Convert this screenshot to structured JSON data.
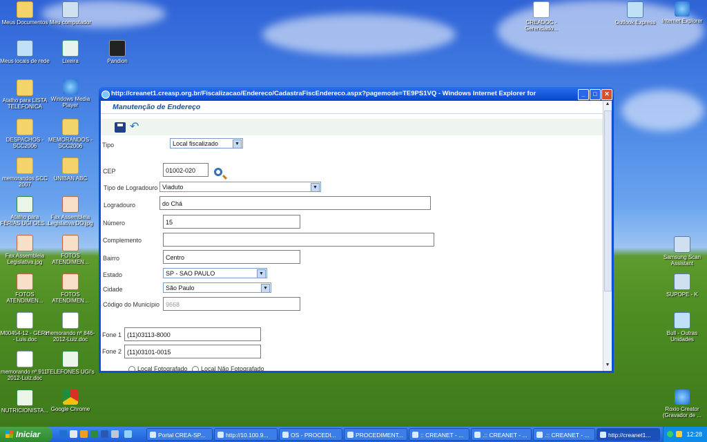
{
  "desktop": {
    "icons": [
      {
        "label": "Meus Documentos",
        "icon": "folder-icon"
      },
      {
        "label": "Meu computador",
        "icon": "computer-icon"
      },
      {
        "label": "Meus locais de rede",
        "icon": "network-icon"
      },
      {
        "label": "Lixeira",
        "icon": "recycle-bin-icon"
      },
      {
        "label": "Pandion",
        "icon": "pandion-icon"
      },
      {
        "label": "Atalho para LISTA TELEFONICA",
        "icon": "folder-icon"
      },
      {
        "label": "Windows Media Player",
        "icon": "media-player-icon"
      },
      {
        "label": "DESPACHOS - SCC2006",
        "icon": "folder-icon"
      },
      {
        "label": "MEMORANDOS - SCC2006",
        "icon": "folder-icon"
      },
      {
        "label": "memorandos SCC 2007",
        "icon": "folder-icon"
      },
      {
        "label": "UNIBAN ABC",
        "icon": "folder-icon"
      },
      {
        "label": "Atalho para FÉRIAS UGI OES...",
        "icon": "excel-icon"
      },
      {
        "label": "Fax Assembleia Legislativa DO.jpg",
        "icon": "image-icon"
      },
      {
        "label": "Fax Assembleia Legislativa.jpg",
        "icon": "image-icon"
      },
      {
        "label": "FOTOS ATENDIMEN...",
        "icon": "image-icon"
      },
      {
        "label": "FOTOS ATENDIMEN...",
        "icon": "image-icon"
      },
      {
        "label": "FOTOS ATENDIMEN...",
        "icon": "image-icon"
      },
      {
        "label": "M00454-12 - GERH - Luis.doc",
        "icon": "word-icon"
      },
      {
        "label": "memorando nº 846-2012-Luiz.doc",
        "icon": "word-icon"
      },
      {
        "label": "memorando nº 911-2012-Luiz.doc",
        "icon": "word-icon"
      },
      {
        "label": "TELEFONES UGI's",
        "icon": "excel-icon"
      },
      {
        "label": "NUTRICIONISTA...",
        "icon": "excel-icon"
      },
      {
        "label": "Google Chrome",
        "icon": "chrome-icon"
      },
      {
        "label": "CREADOC - Gerenciado...",
        "icon": "creadoc-icon"
      },
      {
        "label": "Outlook Express",
        "icon": "outlook-icon"
      },
      {
        "label": "Internet Explorer",
        "icon": "ie-icon"
      },
      {
        "label": "Samsung Scan Assistant",
        "icon": "scanner-icon"
      },
      {
        "label": "SUPOPE - K",
        "icon": "drive-icon"
      },
      {
        "label": "Bull - Outras Unidades",
        "icon": "shortcut-icon"
      },
      {
        "label": "Roxio Creator (Gravador de ...",
        "icon": "roxio-icon"
      }
    ]
  },
  "ie": {
    "title": "http://creanet1.creasp.org.br/Fiscalizacao/Endereco/CadastraFiscEndereco.aspx?pagemode=TE9PS1VQ - Windows Internet Explorer for"
  },
  "form": {
    "title": "Manutenção de Endereço",
    "tipo": {
      "label": "Tipo",
      "value": "Local fiscalizado"
    },
    "cep": {
      "label": "CEP",
      "value": "01002-020"
    },
    "tipo_logradouro": {
      "label": "Tipo de Logradouro",
      "value": "Viaduto"
    },
    "logradouro": {
      "label": "Logradouro",
      "value": "do Chá"
    },
    "numero": {
      "label": "Número",
      "value": "15"
    },
    "complemento": {
      "label": "Complemento",
      "value": ""
    },
    "bairro": {
      "label": "Bairro",
      "value": "Centro"
    },
    "estado": {
      "label": "Estado",
      "value": "SP - SAO PAULO"
    },
    "cidade": {
      "label": "Cidade",
      "value": "São Paulo"
    },
    "codigo_municipio": {
      "label": "Código do Município",
      "value": "9668"
    },
    "fone1": {
      "label": "Fone 1",
      "value": "(11)03113-8000"
    },
    "fone2": {
      "label": "Fone 2",
      "value": "(11)03101-0015"
    },
    "radio_fotografado": "Local Fotografado",
    "radio_nao_fotografado": "Local Não Fotografado"
  },
  "taskbar": {
    "start": "Iniciar",
    "tasks": [
      "Portal CREA-SP...",
      "http://10.100.9...",
      "OS - PROCEDI...",
      "PROCEDIMENT...",
      ":: CREANET - ...",
      ".:: CREANET - ...",
      ".:: CREANET - ...",
      "http://creanet1..."
    ],
    "clock": "12:28"
  }
}
